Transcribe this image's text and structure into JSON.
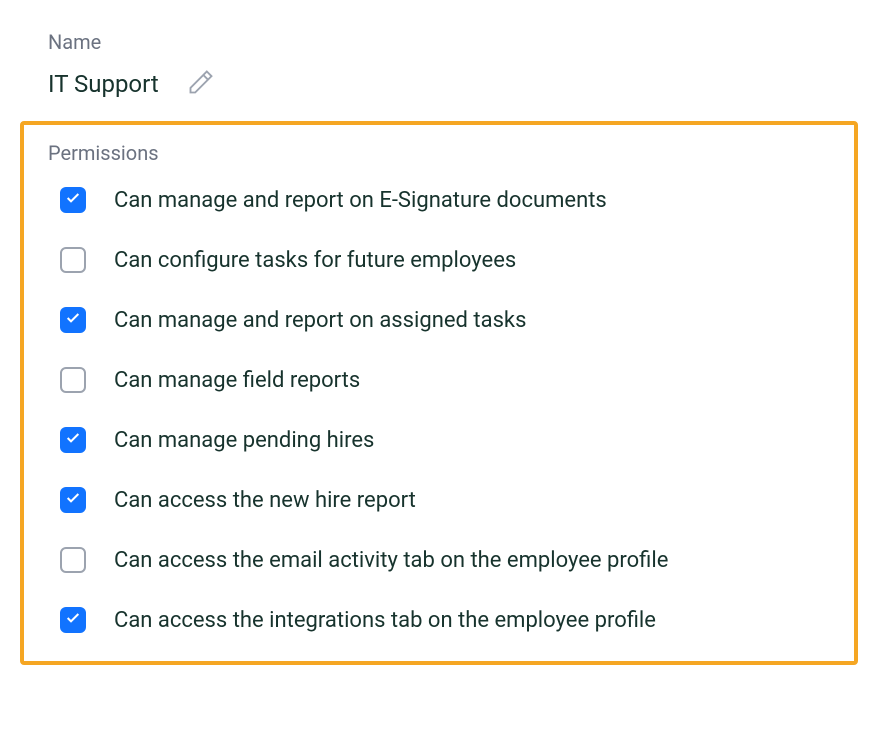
{
  "name_field": {
    "label": "Name",
    "value": "IT Support"
  },
  "permissions": {
    "label": "Permissions",
    "items": [
      {
        "label": "Can manage and report on E-Signature documents",
        "checked": true
      },
      {
        "label": "Can configure tasks for future employees",
        "checked": false
      },
      {
        "label": "Can manage and report on assigned tasks",
        "checked": true
      },
      {
        "label": "Can manage field reports",
        "checked": false
      },
      {
        "label": "Can manage pending hires",
        "checked": true
      },
      {
        "label": "Can access the new hire report",
        "checked": true
      },
      {
        "label": "Can access the email activity tab on the employee profile",
        "checked": false
      },
      {
        "label": "Can access the integrations tab on the employee profile",
        "checked": true
      }
    ]
  }
}
